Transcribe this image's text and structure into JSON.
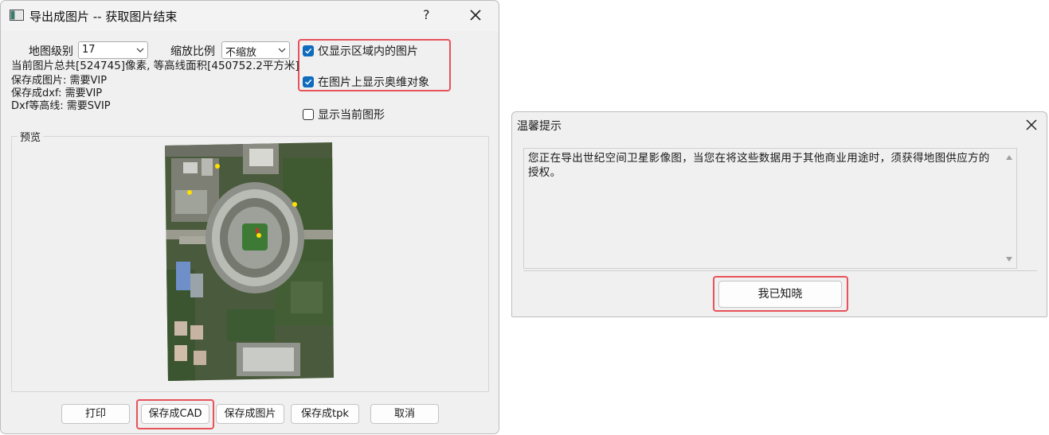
{
  "export_dialog": {
    "title": "导出成图片 -- 获取图片结束",
    "help_label": "?",
    "map_level_label": "地图级别",
    "map_level_value": "17",
    "scale_label": "缩放比例",
    "scale_value": "不缩放",
    "only_region_label": "仅显示区域内的图片",
    "only_region_checked": true,
    "show_objects_label": "在图片上显示奥维对象",
    "show_objects_checked": true,
    "show_current_shape_label": "显示当前图形",
    "show_current_shape_checked": false,
    "info_pixels": "当前图片总共[524745]像素, 等高线面积[450752.2平方米]",
    "info_save_image": "保存成图片: 需要VIP",
    "info_save_dxf": "保存成dxf: 需要VIP",
    "info_dxf_contour": "Dxf等高线: 需要SVIP",
    "preview_label": "预览",
    "buttons": {
      "print": "打印",
      "save_cad": "保存成CAD",
      "save_image": "保存成图片",
      "save_tpk": "保存成tpk",
      "cancel": "取消"
    }
  },
  "tip_dialog": {
    "title": "温馨提示",
    "message": "您正在导出世纪空间卫星影像图，当您在将这些数据用于其他商业用途时，须获得地图供应方的授权。",
    "ok_label": "我已知晓"
  },
  "colors": {
    "accent": "#0f6cbd",
    "highlight": "#e8525a"
  }
}
